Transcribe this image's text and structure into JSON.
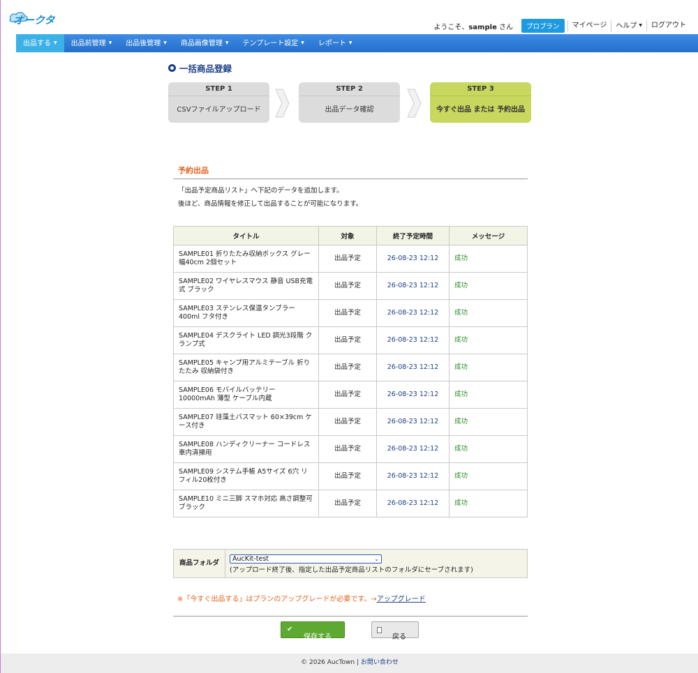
{
  "logo_text": "オークタウン",
  "user_nav": {
    "welcome_prefix": "ようこそ、",
    "username": "sample",
    "welcome_suffix": " さん",
    "plan_badge": "プロプラン",
    "mypage": "マイページ",
    "help": "ヘルプ",
    "logout": "ログアウト"
  },
  "main_nav": [
    {
      "label": "出品する"
    },
    {
      "label": "出品前管理"
    },
    {
      "label": "出品後管理"
    },
    {
      "label": "商品画像管理"
    },
    {
      "label": "テンプレート設定"
    },
    {
      "label": "レポート"
    }
  ],
  "page_title": "一括商品登録",
  "steps": [
    {
      "head": "STEP 1",
      "body": "CSVファイルアップロード"
    },
    {
      "head": "STEP 2",
      "body": "出品データ確認"
    },
    {
      "head": "STEP 3",
      "body": "今すぐ出品 または 予約出品"
    }
  ],
  "section": {
    "title": "予約出品",
    "desc1": "「出品予定商品リスト」へ下記のデータを追加します。",
    "desc2": "後ほど、商品情報を修正して出品することが可能になります。"
  },
  "table": {
    "headers": [
      "タイトル",
      "対象",
      "終了予定時間",
      "メッセージ"
    ],
    "rows": [
      {
        "title": "SAMPLE01 折りたたみ収納ボックス グレー 幅40cm 2個セット",
        "target": "出品予定",
        "time": "26-08-23 12:12",
        "msg": "成功"
      },
      {
        "title": "SAMPLE02 ワイヤレスマウス 静音 USB充電式 ブラック",
        "target": "出品予定",
        "time": "26-08-23 12:12",
        "msg": "成功"
      },
      {
        "title": "SAMPLE03 ステンレス保温タンブラー 400ml フタ付き",
        "target": "出品予定",
        "time": "26-08-23 12:12",
        "msg": "成功"
      },
      {
        "title": "SAMPLE04 デスクライト LED 調光3段階 クランプ式",
        "target": "出品予定",
        "time": "26-08-23 12:12",
        "msg": "成功"
      },
      {
        "title": "SAMPLE05 キャンプ用アルミテーブル 折りたたみ 収納袋付き",
        "target": "出品予定",
        "time": "26-08-23 12:12",
        "msg": "成功"
      },
      {
        "title": "SAMPLE06 モバイルバッテリー 10000mAh 薄型 ケーブル内蔵",
        "target": "出品予定",
        "time": "26-08-23 12:12",
        "msg": "成功"
      },
      {
        "title": "SAMPLE07 珪藻土バスマット 60×39cm ケース付き",
        "target": "出品予定",
        "time": "26-08-23 12:12",
        "msg": "成功"
      },
      {
        "title": "SAMPLE08 ハンディクリーナー コードレス 車内清掃用",
        "target": "出品予定",
        "time": "26-08-23 12:12",
        "msg": "成功"
      },
      {
        "title": "SAMPLE09 システム手帳 A5サイズ 6穴 リフィル20枚付き",
        "target": "出品予定",
        "time": "26-08-23 12:12",
        "msg": "成功"
      },
      {
        "title": "SAMPLE10 ミニ三脚 スマホ対応 高さ調整可 ブラック",
        "target": "出品予定",
        "time": "26-08-23 12:12",
        "msg": "成功"
      }
    ]
  },
  "folder": {
    "label": "商品フォルダ",
    "selected": "AucKit-test",
    "note": "(アップロード終了後、指定した出品予定商品リストのフォルダにセーブされます)"
  },
  "upgrade": {
    "note": "※「今すぐ出品する」はプランのアップグレードが必要です。",
    "arrow": "→",
    "link": "アップグレード"
  },
  "buttons": {
    "save": "保存する",
    "back": "戻る"
  },
  "footer": {
    "copyright": "© 2026 AucTown | ",
    "contact": "お問い合わせ"
  },
  "colors": {
    "nav_blue": "#2a78d3",
    "nav_active": "#3cb1e8",
    "step_active": "#c8d75e",
    "accent_orange": "#e5621e",
    "success_green": "#2a8a25",
    "save_green": "#5ea931"
  }
}
